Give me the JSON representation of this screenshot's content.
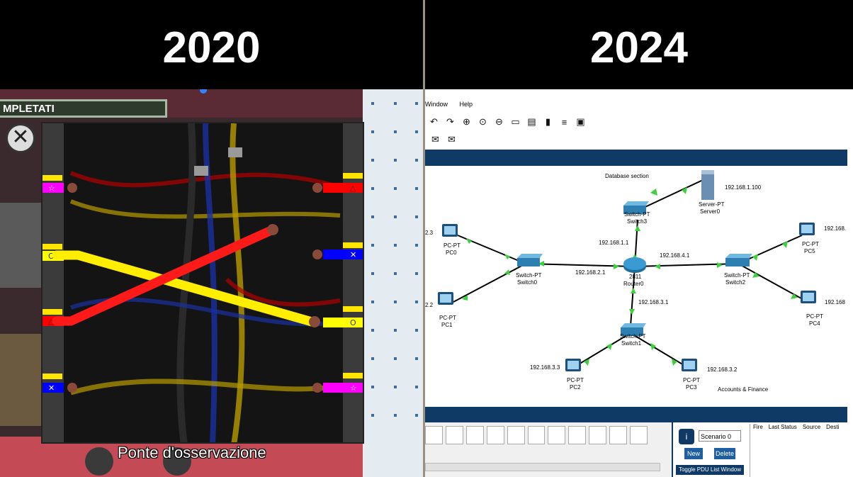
{
  "left": {
    "year": "2020",
    "game": {
      "progress_label": "MPLETATI",
      "close_symbol": "✕",
      "room_label": "Ponte d'osservazione",
      "left_wire_colors": [
        "#ff00ff",
        "#ffff00",
        "#ff0000",
        "#0000ff"
      ],
      "right_wire_colors": [
        "#ff0000",
        "#0000ff",
        "#ffff00",
        "#ff00ff"
      ],
      "left_symbols": [
        "☆",
        "O",
        "△",
        "✕"
      ],
      "right_symbols": [
        "△",
        "✕",
        "O",
        "☆"
      ]
    }
  },
  "right": {
    "year": "2024",
    "menu": [
      "Window",
      "Help"
    ],
    "toolbar_icons": [
      "undo-icon",
      "redo-icon",
      "zoom-in-icon",
      "zoom-reset-icon",
      "zoom-out-icon",
      "window-icon",
      "list-icon",
      "doc-icon",
      "palette-icon",
      "image-icon"
    ],
    "toolbar2_icons": [
      "mail-icon",
      "open-mail-icon"
    ],
    "network": {
      "labels": {
        "database_section": "Database section",
        "accounts_finance": "Accounts & Finance",
        "server_ip": "192.168.1.100",
        "server_type": "Server-PT",
        "server_name": "Server0",
        "switch3_type": "Switch-PT",
        "switch3_name": "Switch3",
        "ip_1_1": "192.168.1.1",
        "ip_4_1": "192.168.4.1",
        "ip_2_1": "192.168.2.1",
        "ip_3_1": "192.168.3.1",
        "router_model": "2811",
        "router_name": "Router0",
        "switch0_type": "Switch-PT",
        "switch0_name": "Switch0",
        "switch2_type": "Switch-PT",
        "switch2_name": "Switch2",
        "switch1_type": "Switch-PT",
        "switch1_name": "Switch1",
        "pc0_ip": "2.3",
        "pc0_type": "PC-PT",
        "pc0_name": "PC0",
        "pc1_ip": "2.2",
        "pc1_type": "PC-PT",
        "pc1_name": "PC1",
        "pc2_ip": "192.168.3.3",
        "pc2_type": "PC-PT",
        "pc2_name": "PC2",
        "pc3_ip": "192.168.3.2",
        "pc3_type": "PC-PT",
        "pc3_name": "PC3",
        "pc4_ip": "192.168",
        "pc4_type": "PC-PT",
        "pc4_name": "PC4",
        "pc5_ip": "192.168.",
        "pc5_type": "PC-PT",
        "pc5_name": "PC5"
      }
    },
    "simulation": {
      "info_symbol": "i",
      "scenario": "Scenario 0",
      "new_label": "New",
      "delete_label": "Delete",
      "toggle_label": "Toggle PDU List Window",
      "headers": [
        "Fire",
        "Last Status",
        "Source",
        "Desti"
      ]
    },
    "colors": {
      "band": "#0f3a66",
      "link": "#000000",
      "link_light": "#2ecc40"
    }
  }
}
